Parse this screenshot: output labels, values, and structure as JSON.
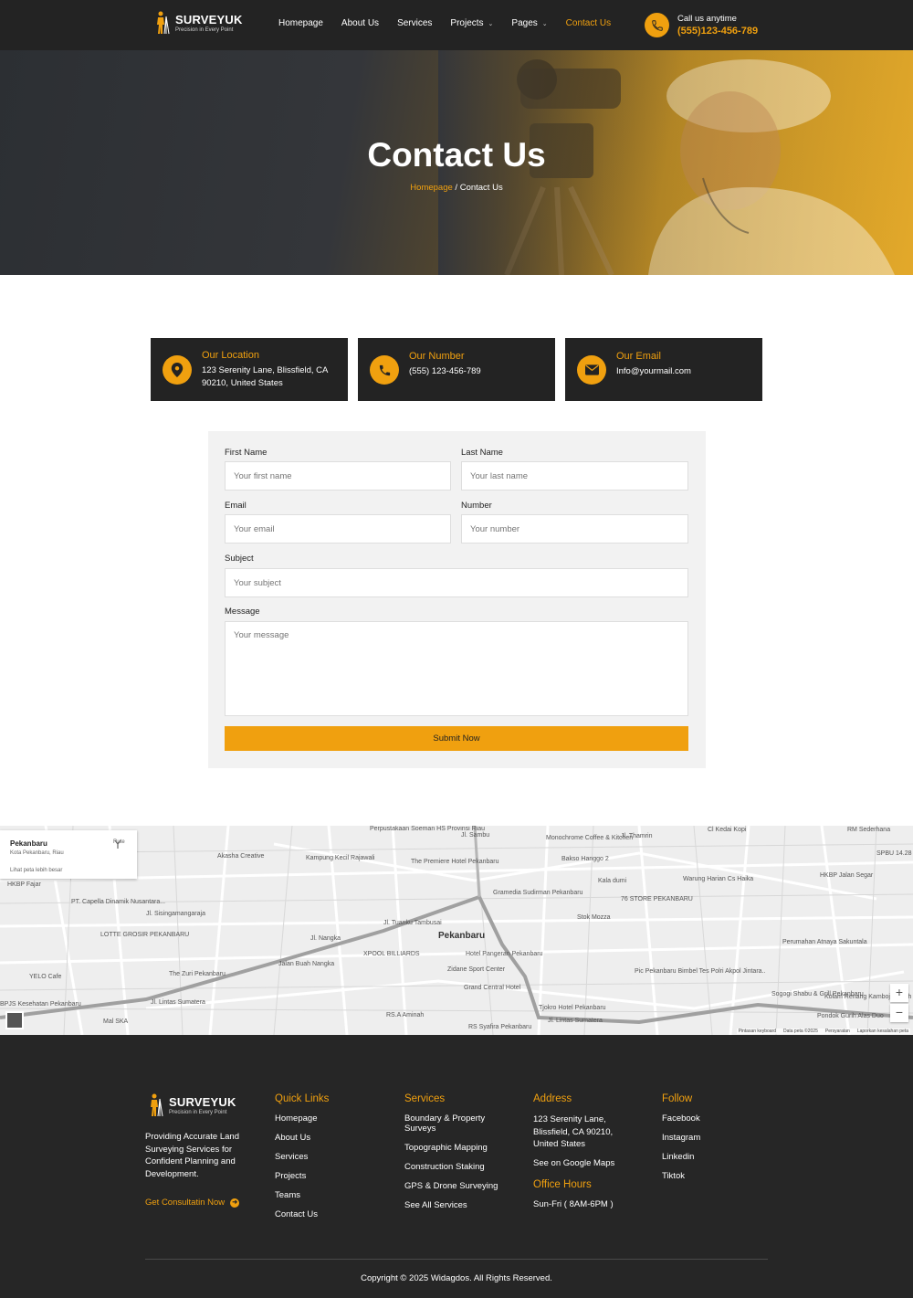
{
  "brand": {
    "name": "SURVEYUK",
    "tagline": "Precision in Every Point",
    "accent": "#f0a00f",
    "dark": "#232323"
  },
  "nav": {
    "items": [
      {
        "label": "Homepage",
        "has_caret": false
      },
      {
        "label": "About Us",
        "has_caret": false
      },
      {
        "label": "Services",
        "has_caret": false
      },
      {
        "label": "Projects",
        "has_caret": true
      },
      {
        "label": "Pages",
        "has_caret": true
      },
      {
        "label": "Contact Us",
        "has_caret": false,
        "active": true
      }
    ],
    "call_label": "Call us anytime",
    "call_number": "(555)123-456-789",
    "call_icon": "phone-icon"
  },
  "hero": {
    "title": "Contact Us",
    "breadcrumb_link": "Homepage",
    "breadcrumb_separator": " / ",
    "breadcrumb_current": "Contact Us"
  },
  "info_cards": [
    {
      "icon": "location-pin-icon",
      "title": "Our Location",
      "text": "123 Serenity Lane, Blissfield, CA 90210, United States"
    },
    {
      "icon": "phone-icon",
      "title": "Our Number",
      "text": "(555) 123-456-789"
    },
    {
      "icon": "envelope-icon",
      "title": "Our Email",
      "text": "Info@yourmail.com"
    }
  ],
  "form": {
    "first_name_label": "First Name",
    "first_name_placeholder": "Your first name",
    "last_name_label": "Last Name",
    "last_name_placeholder": "Your last name",
    "email_label": "Email",
    "email_placeholder": "Your email",
    "number_label": "Number",
    "number_placeholder": "Your number",
    "subject_label": "Subject",
    "subject_placeholder": "Your subject",
    "message_label": "Message",
    "message_placeholder": "Your message",
    "submit_label": "Submit Now"
  },
  "map": {
    "info_title": "Pekanbaru",
    "info_subtitle": "Kota Pekanbaru, Riau",
    "info_link": "Lihat peta lebih besar",
    "route_label": "Rute",
    "city_label": "Pekanbaru",
    "labels": [
      "Perpustakaan Soeman HS Provinsi Riau",
      "Jl. Sambu",
      "Monochrome Coffee & Kitchen",
      "Jl. Thamrin",
      "Cl Kedai Kopi",
      "RM Sederhana",
      "Akasha Creative",
      "Kampung Kecil Rajawali",
      "The Premiere Hotel Pekanbaru",
      "Bakso Hanggo 2",
      "SPBU 14.28",
      "HKBP Fajar",
      "PT. Capella Dinamik Nusantara...",
      "Jl. Sisingamangaraja",
      "Gramedia Sudirman Pekanbaru",
      "Kala dumi",
      "Warung Harian Cs Haika",
      "HKBP Jalan Segar",
      "76 STORE PEKANBARU",
      "LOTTE GROSIR PEKANBARU",
      "Stok Mozza",
      "Perumahan Atnaya Sakuntala",
      "XPOOL BILLIARDS",
      "Hotel Pangeran Pekanbaru",
      "Zidane Sport Center",
      "The Zuri Pekanbaru",
      "Jalan Buah Nangka",
      "YELO Cafe",
      "Grand Central Hotel",
      "Pic Pekanbaru Bimbel Tes Polri Akpol Jintara..",
      "Sogogi Shabu & Grill Pekanbaru",
      "Kolam Renang Kamboja Indah",
      "BPJS Kesehatan Pekanbaru",
      "Mal SKA",
      "RS.A Aminah",
      "Tjokro Hotel Pekanbaru",
      "RS Syafira Pekanbaru",
      "Pondok Gurih Alas Duo",
      "Jl. Lintas Sumatera",
      "Jl. Nangka",
      "Jl. Tuanku Tambusai",
      "Jl. Lintas Sumatera"
    ],
    "zoom_in": "+",
    "zoom_out": "−",
    "attribution": [
      "Pintasan keyboard",
      "Data peta ©2025",
      "Persyaratan",
      "Laporkan kesalahan peta"
    ]
  },
  "footer": {
    "description": "Providing Accurate Land Surveying Services for Confident Planning and Development.",
    "cta": "Get Consultatin Now",
    "quick_links_title": "Quick Links",
    "quick_links": [
      "Homepage",
      "About Us",
      "Services",
      "Projects",
      "Teams",
      "Contact Us"
    ],
    "services_title": "Services",
    "services": [
      "Boundary & Property Surveys",
      "Topographic Mapping",
      "Construction Staking",
      "GPS & Drone Surveying",
      "See All Services"
    ],
    "address_title": "Address",
    "address": "123 Serenity Lane, Blissfield, CA 90210, United States",
    "maps_link": "See on Google Maps",
    "hours_title": "Office Hours",
    "hours": "Sun-Fri ( 8AM-6PM )",
    "follow_title": "Follow",
    "follow": [
      "Facebook",
      "Instagram",
      "Linkedin",
      "Tiktok"
    ],
    "copyright": "Copyright © 2025 Widagdos. All Rights Reserved."
  }
}
